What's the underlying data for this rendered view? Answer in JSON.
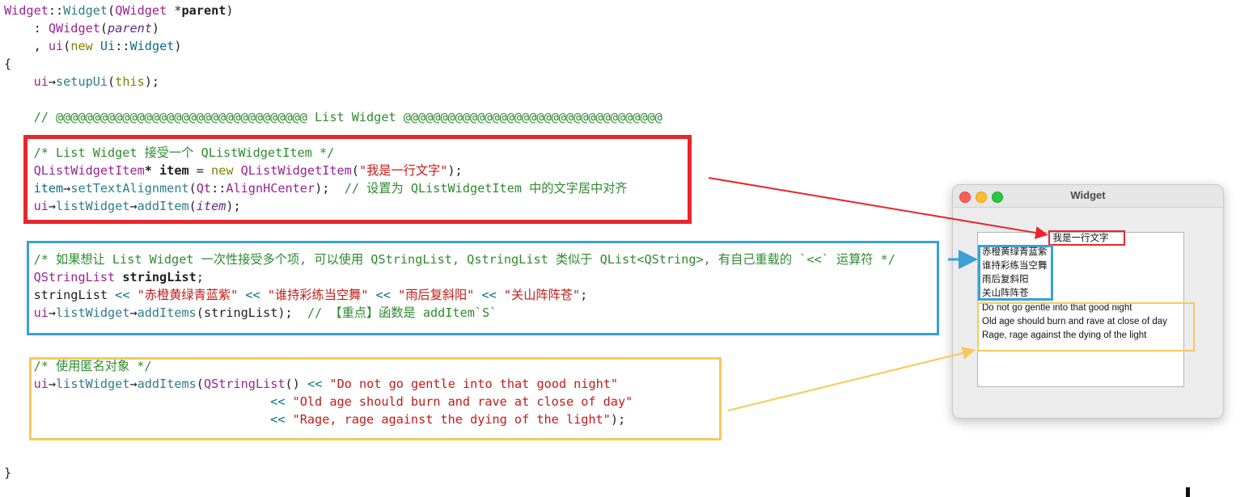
{
  "code": {
    "ctor_class": "Widget",
    "ctor_sep": "::",
    "ctor_name": "Widget",
    "ctor_param_type": "QWidget",
    "ctor_param_name": "parent",
    "init_base": "QWidget",
    "init_arg": "parent",
    "ui_new_type": "Widget",
    "setup_call": "setupUi",
    "section_comment": "// @@@@@@@@@@@@@@@@@@@@@@@@@@@@@@@@@@ List Widget @@@@@@@@@@@@@@@@@@@@@@@@@@@@@@@@@@@",
    "block1": {
      "comment": "/* List Widget 接受一个 QListWidgetItem */",
      "item_type": "QListWidgetItem",
      "item_var": "item",
      "item_text": "\"我是一行文字\"",
      "set_align": "setTextAlignment",
      "align_ns": "Qt",
      "align_val": "AlignHCenter",
      "align_comment": "// 设置为 QListWidgetItem 中的文字居中对齐",
      "list_widget": "listWidget",
      "add_item": "addItem"
    },
    "block2": {
      "comment": "/* 如果想让 List Widget 一次性接受多个项, 可以使用 QStringList, QstringList 类似于 QList<QString>, 有自己重载的 `<<` 运算符 */",
      "type": "QStringList",
      "var": "stringList",
      "s1": "\"赤橙黄绿青蓝紫\"",
      "s2": "\"谁持彩练当空舞\"",
      "s3": "\"雨后复斜阳\"",
      "s4": "\"关山阵阵苍\"",
      "add_items": "addItems",
      "note": "// 【重点】函数是 addItem`S`"
    },
    "block3": {
      "comment": "/* 使用匿名对象 */",
      "q1": "\"Do not go gentle into that good night\"",
      "q2": "\"Old age should burn and rave at close of day\"",
      "q3": "\"Rage, rage against the dying of the light\""
    }
  },
  "window": {
    "title": "Widget",
    "items": [
      "我是一行文字",
      "赤橙黄绿青蓝紫",
      "谁持彩练当空舞",
      "雨后复斜阳",
      "关山阵阵苍",
      "Do not go gentle into that good night",
      "Old age should burn and rave at close of day",
      "Rage, rage against the dying of the light"
    ]
  },
  "colors": {
    "red": "#e8262b",
    "blue": "#3aa0d6",
    "yellow": "#f7c95a",
    "traffic_close": "#ff5f57",
    "traffic_min": "#febc2e",
    "traffic_max": "#28c840"
  }
}
